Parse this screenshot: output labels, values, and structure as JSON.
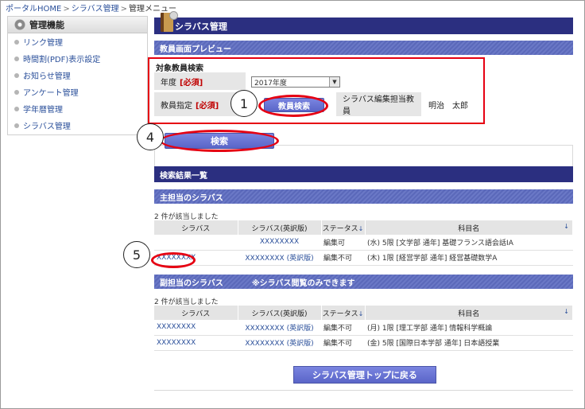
{
  "breadcrumb": {
    "items": [
      "ポータルHOME",
      "シラバス管理",
      "管理メニュー"
    ],
    "separator": ">"
  },
  "sidebar": {
    "title": "管理機能",
    "items": [
      {
        "label": "リンク管理"
      },
      {
        "label": "時間割(PDF)表示設定"
      },
      {
        "label": "お知らせ管理"
      },
      {
        "label": "アンケート管理"
      },
      {
        "label": "学年暦管理"
      },
      {
        "label": "シラバス管理"
      }
    ]
  },
  "main": {
    "title": "シラバス管理",
    "preview_title": "教員画面プレビュー",
    "search": {
      "section_label": "対象教員検索",
      "year_label": "年度",
      "year_required": "[必須]",
      "year_value": "2017年度",
      "teacher_label": "教員指定",
      "teacher_required": "[必須]",
      "teacher_search_button": "教員検索",
      "editor_label": "シラバス編集担当教員",
      "editor_value": "明治　太郎"
    },
    "search_button": "検索",
    "results_title": "検索結果一覧",
    "primary": {
      "title": "主担当のシラバス",
      "count": "2 件が該当しました",
      "headers": [
        "シラバス",
        "シラバス(英訳版)",
        "ステータス",
        "科目名"
      ],
      "rows": [
        {
          "syllabus": "",
          "english": "XXXXXXXX",
          "status": "編集可",
          "subject": "(水) 5限 [文学部 通年] 基礎フランス語会話IA"
        },
        {
          "syllabus": "XXXXXXXX",
          "english": "XXXXXXXX (英訳版)",
          "status": "編集不可",
          "subject": "(木) 1限 [経営学部 通年] 経営基礎数学A"
        }
      ]
    },
    "secondary": {
      "title": "副担当のシラバス",
      "note": "※シラバス閲覧のみできます",
      "count": "2 件が該当しました",
      "headers": [
        "シラバス",
        "シラバス(英訳版)",
        "ステータス",
        "科目名"
      ],
      "rows": [
        {
          "syllabus": "XXXXXXXX",
          "english": "XXXXXXXX (英訳版)",
          "status": "編集不可",
          "subject": "(月) 1限 [理工学部 通年] 情報科学概論"
        },
        {
          "syllabus": "XXXXXXXX",
          "english": "XXXXXXXX (英訳版)",
          "status": "編集不可",
          "subject": "(金) 5限 [国際日本学部 通年] 日本語授業"
        }
      ]
    },
    "back_button": "シラバス管理トップに戻る"
  },
  "callouts": [
    "1",
    "4",
    "5"
  ],
  "colors": {
    "navy": "#2b2f80",
    "accent_red": "#e60012",
    "button": "#5a65c8",
    "link": "#2a4f9a"
  }
}
